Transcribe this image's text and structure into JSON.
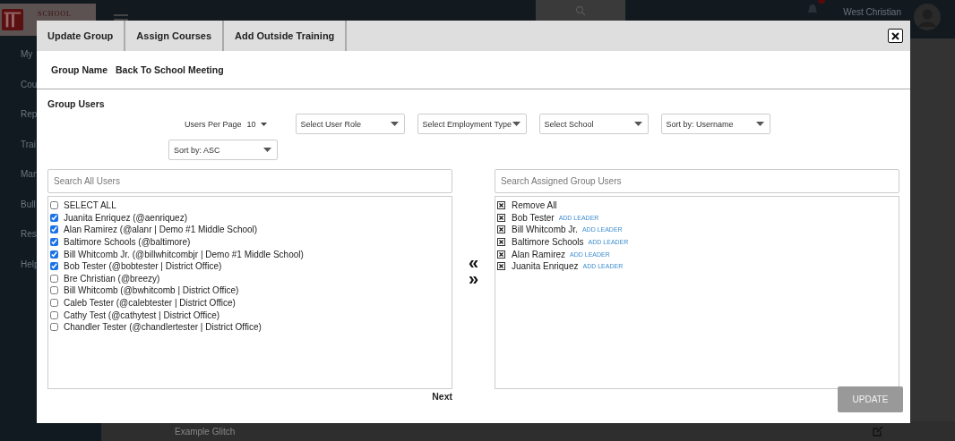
{
  "app": {
    "logo_text": "SCHOOL",
    "sidebar": [
      "My",
      "Cou",
      "Rep",
      "Trai",
      "Man",
      "Bull",
      "Res",
      "Help"
    ],
    "user_name": "West Christian",
    "row_text": "Example Glitch"
  },
  "modal": {
    "tabs": [
      "Update Group",
      "Assign Courses",
      "Add Outside Training"
    ],
    "group_name_label": "Group Name",
    "group_name": "Back To School Meeting",
    "section_title": "Group Users",
    "per_page_label": "Users Per Page",
    "per_page": "10",
    "filters": [
      "Select User Role",
      "Select Employment Type",
      "Select School",
      "Sort by: Username"
    ],
    "sort_order": "Sort by: ASC",
    "all_users": {
      "placeholder": "Search All Users",
      "select_all": {
        "label": "SELECT ALL",
        "checked": false
      },
      "users": [
        {
          "label": "Juanita Enriquez (@aenriquez)",
          "checked": true
        },
        {
          "label": "Alan Ramirez (@alanr | Demo #1 Middle School)",
          "checked": true
        },
        {
          "label": "Baltimore Schools (@baltimore)",
          "checked": true
        },
        {
          "label": "Bill Whitcomb Jr. (@billwhitcombjr | Demo #1 Middle School)",
          "checked": true
        },
        {
          "label": "Bob Tester (@bobtester | District Office)",
          "checked": true
        },
        {
          "label": "Bre Christian (@breezy)",
          "checked": false
        },
        {
          "label": "Bill Whitcomb (@bwhitcomb | District Office)",
          "checked": false
        },
        {
          "label": "Caleb Tester (@calebtester | District Office)",
          "checked": false
        },
        {
          "label": "Cathy Test (@cathytest | District Office)",
          "checked": false
        },
        {
          "label": "Chandler Tester (@chandlertester | District Office)",
          "checked": false
        }
      ]
    },
    "next": "Next",
    "move_left": "«",
    "move_right": "»",
    "assigned": {
      "placeholder": "Search Assigned Group Users",
      "remove_all": "Remove All",
      "users": [
        {
          "name": "Bob Tester",
          "action": "ADD LEADER"
        },
        {
          "name": "Bill Whitcomb Jr.",
          "action": "ADD LEADER"
        },
        {
          "name": "Baltimore Schools",
          "action": "ADD LEADER"
        },
        {
          "name": "Alan Ramirez",
          "action": "ADD LEADER"
        },
        {
          "name": "Juanita Enriquez",
          "action": "ADD LEADER"
        }
      ]
    },
    "update": "UPDATE"
  }
}
